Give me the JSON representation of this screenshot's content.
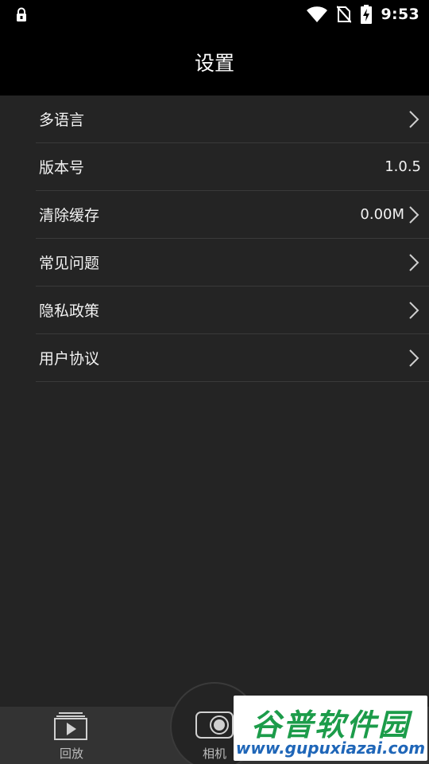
{
  "status_bar": {
    "time": "9:53",
    "icons": [
      "lock-icon",
      "wifi-icon",
      "no-sim-icon",
      "battery-charging-icon"
    ]
  },
  "header": {
    "title": "设置"
  },
  "settings": {
    "items": [
      {
        "label": "多语言",
        "value": "",
        "chevron": true
      },
      {
        "label": "版本号",
        "value": "1.0.5",
        "chevron": false
      },
      {
        "label": "清除缓存",
        "value": "0.00M",
        "chevron": true
      },
      {
        "label": "常见问题",
        "value": "",
        "chevron": true
      },
      {
        "label": "隐私政策",
        "value": "",
        "chevron": true
      },
      {
        "label": "用户协议",
        "value": "",
        "chevron": true
      }
    ]
  },
  "bottom_nav": {
    "items": [
      {
        "label": "回放",
        "icon": "playback-icon"
      },
      {
        "label": "相机",
        "icon": "camera-icon"
      }
    ]
  },
  "watermark": {
    "title": "谷普软件园",
    "url": "www.gupuxiazai.com"
  },
  "colors": {
    "background": "#242424",
    "bars": "#000000",
    "nav": "#333333",
    "watermark_green": "#1c9c4a",
    "watermark_blue": "#1f66b8"
  }
}
